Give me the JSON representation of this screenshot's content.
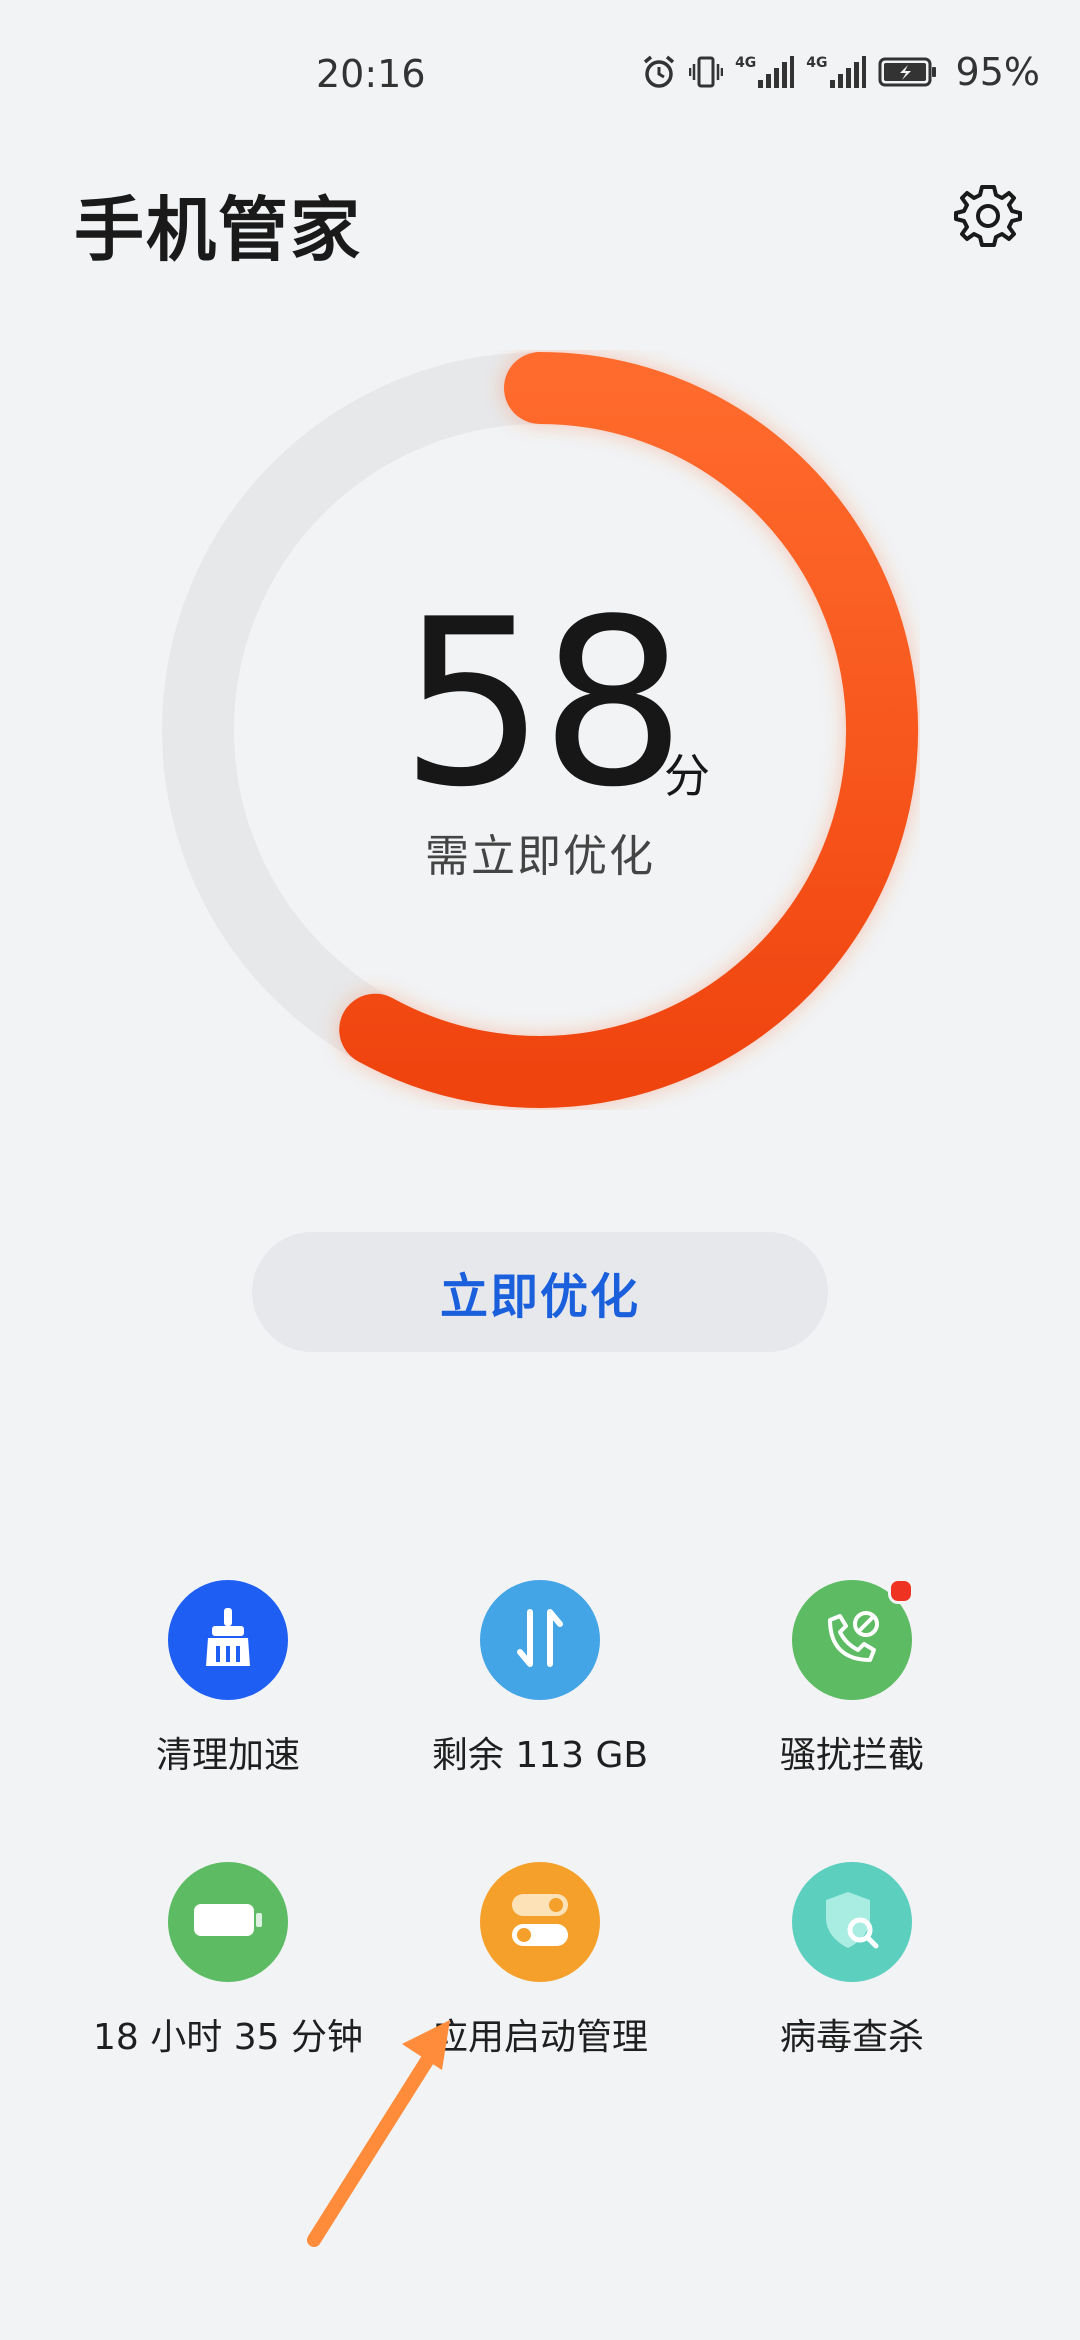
{
  "status_bar": {
    "time": "20:16",
    "battery": "95%",
    "network_1": "4G",
    "network_2": "4G"
  },
  "header": {
    "title": "手机管家"
  },
  "score": {
    "value": "58",
    "unit": "分",
    "status": "需立即优化",
    "progress": 0.58
  },
  "optimize_button": {
    "label": "立即优化"
  },
  "tools": [
    {
      "label": "清理加速",
      "icon": "broom-icon",
      "color": "#1f5ef2"
    },
    {
      "label": "剩余 113 GB",
      "icon": "transfer-icon",
      "color": "#43a4e6"
    },
    {
      "label": "骚扰拦截",
      "icon": "blocked-call-icon",
      "color": "#5dbb63"
    },
    {
      "label": "18 小时 35 分钟",
      "icon": "battery-icon",
      "color": "#5dbb63"
    },
    {
      "label": "应用启动管理",
      "icon": "toggle-switch-icon",
      "color": "#f5a02a"
    },
    {
      "label": "病毒查杀",
      "icon": "shield-search-icon",
      "color": "#5ccfbf"
    }
  ],
  "colors": {
    "accent": "#1a5fdc",
    "ring_start": "#ff6b2c",
    "ring_end": "#f0440f",
    "track": "#e7e8ea"
  }
}
